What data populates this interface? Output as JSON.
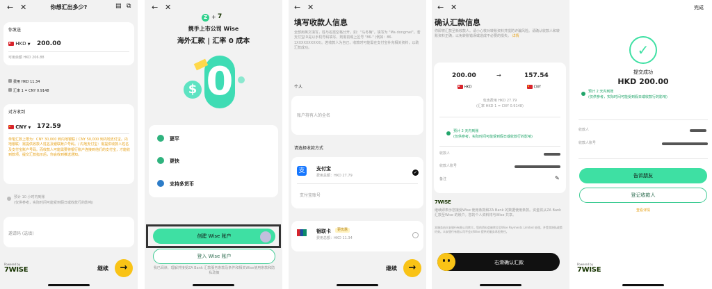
{
  "screen1": {
    "title": "你想汇出多少?",
    "send_label": "你发送",
    "send_currency": "HKD",
    "send_amount": "200.00",
    "available": "可用余额 HKD 206.88",
    "fee": "费用 HKD 11.34",
    "rate": "汇率 1 = CNY 0.9148",
    "receive_label": "对方收到",
    "receive_currency": "CNY",
    "receive_amount": "172.59",
    "notice": "单笔汇款上限为：CNY 30,000 到内地银联 / CNY 50,000 到内地支付宝。内地银联：需提供收款人姓名及银联账户号码。/ 内地支付宝：需提供收款人姓名及支付宝账户号码。而收款人可能需要将银行账户连接到他们的支付宝，才能收到款项。提交汇款指示后，你会收到推送通知。",
    "eta": "预计 10 小时内到账",
    "eta_sub": "(仅供参考，实际时间可能受到假日或收款行的影响)",
    "invite_placeholder": "邀请码 (选填)",
    "continue_label": "继续",
    "powered_by": "Powered by",
    "wise": "7WISE"
  },
  "screen2": {
    "brand_line1": "携手上市公司 Wise",
    "brand_line2": "海外汇款 | 汇率 0 成本",
    "features": [
      {
        "icon": "money-bag-icon",
        "label": "更平"
      },
      {
        "icon": "lightning-icon",
        "label": "更快"
      },
      {
        "icon": "globe-icon",
        "label": "支持多货币"
      }
    ],
    "create_label": "创建 Wise 账户",
    "login_label": "登入 Wise 账户",
    "terms": "我已阅读、理解并接受ZA Bank 汇款服务条款及条件和相关Wise使用条款和隐私政策"
  },
  "screen3": {
    "title": "填写收款人信息",
    "desc": "全部用英文填写，姓与名需空格分开，如：\"马冬梅\"，填写为 \"Ma dongmei\"。若支付宝ID是以手机号码填写，则需前缀上区号 \"86-\" (例如：86-1XXXXXXXXXX)。若收款人为自己，收款时可能需在支付宝补充相关资料，以助汇款成功。",
    "personal_label": "个人",
    "name_placeholder": "账户持有人的全名",
    "method_label": "请选择收款方式",
    "alipay_name": "支付宝",
    "alipay_fee": "费用总额：HKD 27.79",
    "alipay_account_placeholder": "支付宝账号",
    "unionpay_name": "银联卡",
    "unionpay_tag": "更优惠",
    "unionpay_fee": "费用总额：HKD 11.34",
    "continue_label": "继续"
  },
  "screen4": {
    "title": "确认汇款信息",
    "desc": "你即将汇款至新收款人。请小心核对转账资料并提防诈骗风险。请确认收款人和转账资料正确，以免转账错误或造成不必要的损失。",
    "detail_link": "详情",
    "from_amount": "200.00",
    "from_currency": "HKD",
    "to_amount": "157.54",
    "to_currency": "CNY",
    "fee": "包含费用 HKD 27.79",
    "rate": "(汇率 HKD 1 = CNY 0.9148)",
    "eta": "预计 2 天内到账",
    "eta_sub": "(仅供参考，实际时间可能受到假日或收款行的影响)",
    "payee_label": "收款人",
    "account_label": "收款人账号",
    "note_label": "备注",
    "disclaimer": "继续即表示您接受Wise 使用条款和ZA Bank 的数据使用条款。资金将从ZA Bank 汇款至Wise 的账户。您的个人资料将与Wise 共享。",
    "fine_print": "本服务由众安银行有限公司转介。您的资料会被转交至Wise Payments Limited 处理，并受其隐私政策约束。众安银行有限公司不会对Wise 提供的服务承担责任。",
    "slide_label": "右滑确认汇款"
  },
  "screen5": {
    "done_label": "完成",
    "success_title": "提交成功",
    "success_amount": "HKD 200.00",
    "eta": "预计 2 天内到账",
    "eta_sub": "(仅供参考，实际时间可能受到假日或收款行的影响)",
    "payee_label": "收款人",
    "account_label": "收款人账号",
    "tell_friends": "告诉朋友",
    "register_payee": "登记收款人",
    "view_details": "查看详情"
  },
  "colors": {
    "yellow": "#f9c316",
    "green": "#3ee0a3",
    "orange": "#e6a118"
  }
}
